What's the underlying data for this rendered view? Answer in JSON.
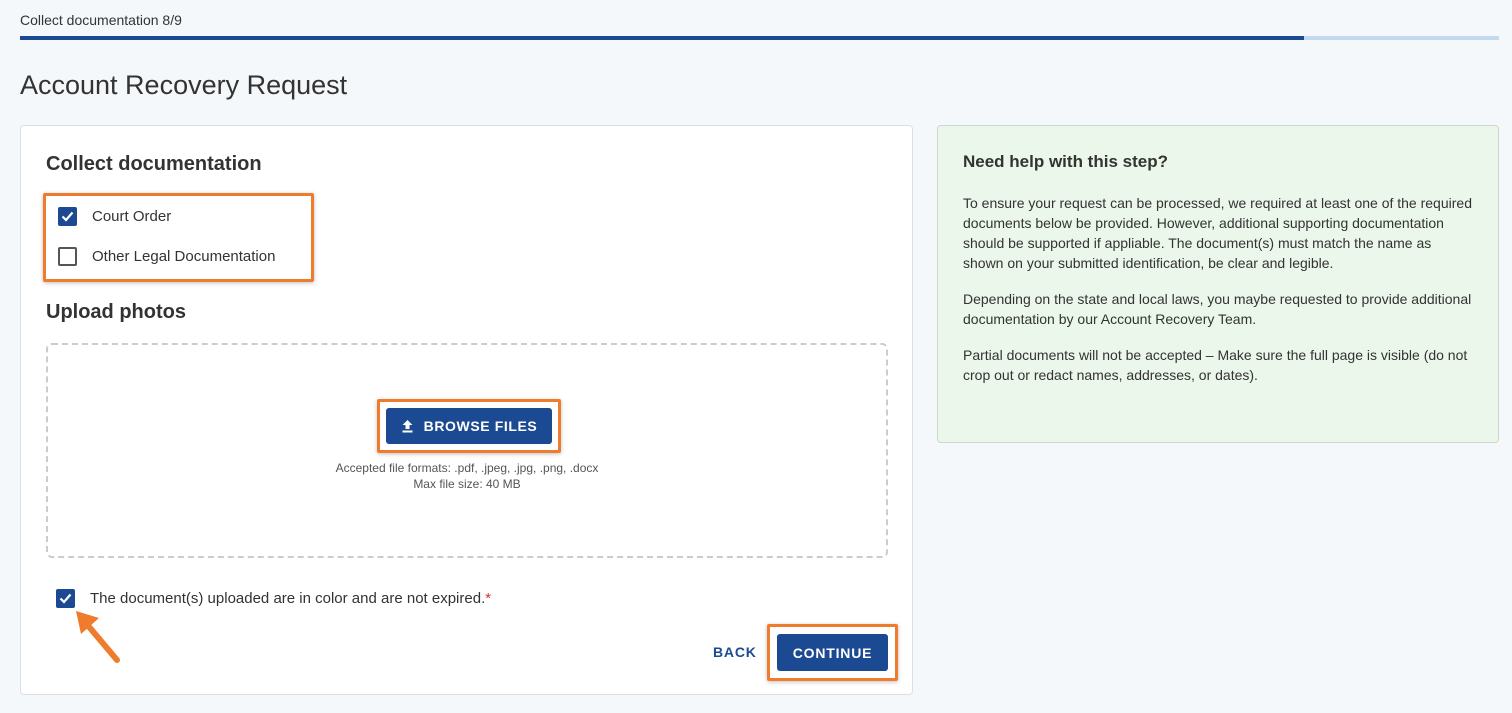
{
  "progress": {
    "step_label": "Collect documentation 8/9",
    "fraction": 0.8681
  },
  "page": {
    "title": "Account Recovery Request"
  },
  "form": {
    "collect_heading": "Collect documentation",
    "document_options": [
      {
        "label": "Court Order",
        "checked": true
      },
      {
        "label": "Other Legal Documentation",
        "checked": false
      }
    ],
    "upload_heading": "Upload photos",
    "browse_label": "BROWSE FILES",
    "upload_icon": "upload-icon",
    "formats_hint": "Accepted file formats: .pdf, .jpeg, .jpg, .png, .docx",
    "size_hint": "Max file size: 40 MB",
    "confirm_label": "The document(s) uploaded are in color and are not expired.",
    "confirm_required_mark": "*",
    "confirm_checked": true,
    "back_label": "BACK",
    "continue_label": "CONTINUE"
  },
  "help": {
    "title": "Need help with this step?",
    "paragraphs": [
      "To ensure your request can be processed, we required at least one of the required documents below be provided. However, additional supporting documentation should be supported if appliable. The document(s) must match the name as shown on your submitted identification, be clear and legible.",
      "Depending on the state and local laws, you maybe requested to provide additional documentation by our Account Recovery Team.",
      "Partial documents will not be accepted – Make sure the full page is visible (do not crop out or redact names, addresses, or dates)."
    ]
  },
  "colors": {
    "primary": "#1b4a93",
    "highlight": "#ef7b2c",
    "help_background": "#eaf7ea",
    "required": "#d0312d"
  }
}
